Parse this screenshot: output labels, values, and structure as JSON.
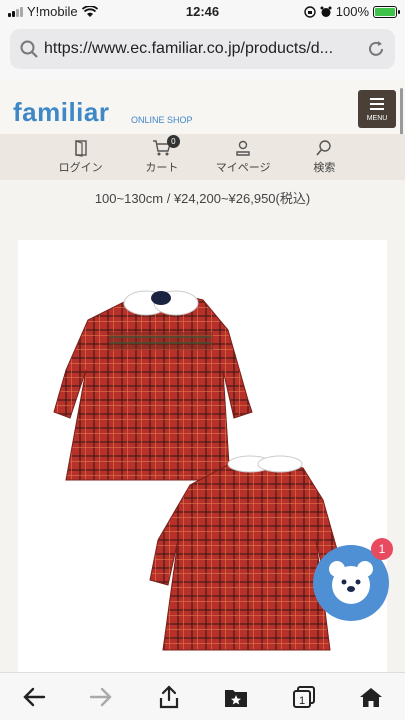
{
  "status_bar": {
    "carrier": "Y!mobile",
    "time": "12:46",
    "battery": "100%"
  },
  "browser": {
    "url": "https://www.ec.familiar.co.jp/products/d..."
  },
  "site": {
    "logo": "familiar",
    "logo_sub": "ONLINE SHOP",
    "menu_label": "MENU"
  },
  "nav": [
    {
      "label": "ログイン",
      "icon": "door-icon"
    },
    {
      "label": "カート",
      "icon": "cart-icon",
      "badge": "0"
    },
    {
      "label": "マイページ",
      "icon": "person-icon"
    },
    {
      "label": "検索",
      "icon": "search-icon"
    }
  ],
  "product": {
    "price_line": "100~130cm / ¥24,200~¥26,950(税込)"
  },
  "chat": {
    "badge": "1"
  },
  "colors": {
    "brand": "#3f88c7",
    "dress": "#b8302a",
    "chat": "#4f8fd3"
  }
}
